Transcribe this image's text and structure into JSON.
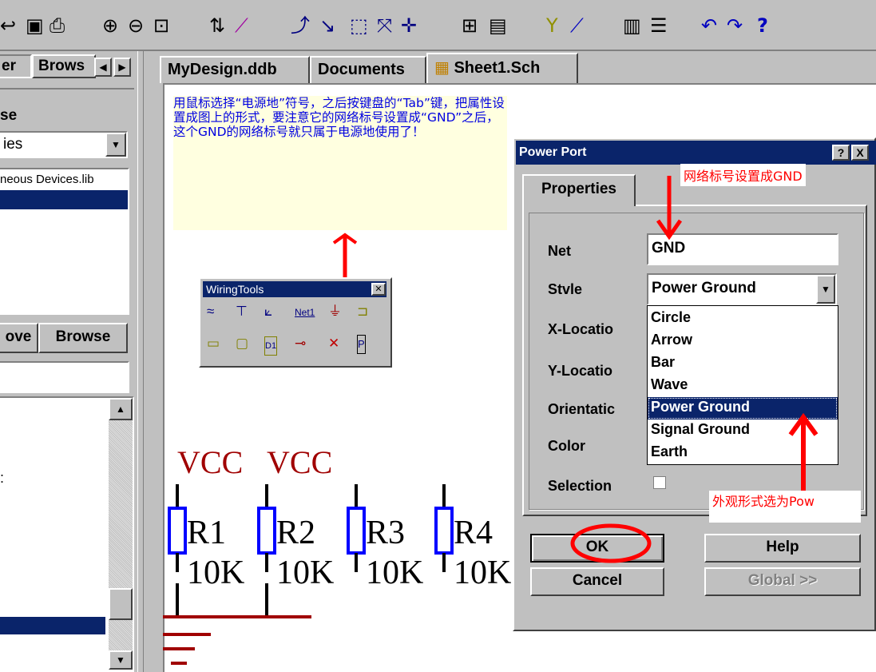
{
  "toolbar": {
    "icons": [
      "save-icon",
      "print-icon",
      "zoom-in-icon",
      "zoom-out-icon",
      "zoom-fit-icon",
      "sort-icon",
      "wand-icon",
      "wire-icon",
      "arrow-icon",
      "select-icon",
      "cross-icon",
      "move-icon",
      "bus-icon",
      "sheet-icon",
      "probe-icon",
      "line-icon",
      "library-icon",
      "list-icon",
      "undo-icon",
      "redo-icon",
      "help-icon"
    ],
    "help_label": "?"
  },
  "left_panel": {
    "tab_partial": "er",
    "tab_browse_partial": "Brows",
    "group_partial": "se",
    "library_select": "ies",
    "library_file": "neous Devices.lib",
    "left_button_partial": "ove",
    "browse_button": "Browse",
    "list_marker": ":"
  },
  "document_tabs": [
    "MyDesign.ddb",
    "Documents",
    "Sheet1.Sch"
  ],
  "note": {
    "text": "用鼠标选择“电源地”符号，之后按键盘的“Tab”键，把属性设置成图上的形式，要注意它的网络标号设置成“GND”之后，这个GND的网络标号就只属于电源地使用了！"
  },
  "wiring_tools": {
    "title": "WiringTools",
    "close": "✕",
    "net_label": "Net1",
    "row1": [
      "≈",
      "⊤",
      "⟀",
      "Net1",
      "⏚",
      "⊐"
    ],
    "row2": [
      "▭",
      "▢",
      "D1",
      "⊸",
      "✕",
      "P"
    ]
  },
  "schematic": {
    "vcc_labels": [
      "VCC",
      "VCC"
    ],
    "resistors": [
      {
        "ref": "R1",
        "value": "10K"
      },
      {
        "ref": "R2",
        "value": "10K"
      },
      {
        "ref": "R3",
        "value": "10K"
      },
      {
        "ref": "R4",
        "value": "10K"
      }
    ]
  },
  "dialog": {
    "title": "Power Port",
    "help_btn": "?",
    "close_btn": "X",
    "tab": "Properties",
    "fields": {
      "net_label": "Net",
      "net_value": "GND",
      "style_label": "Stvle",
      "style_value": "Power Ground",
      "xloc_label": "X-Locatio",
      "yloc_label": "Y-Locatio",
      "orient_label": "Orientatic",
      "color_label": "Color",
      "selection_label": "Selection"
    },
    "style_options": [
      "Circle",
      "Arrow",
      "Bar",
      "Wave",
      "Power Ground",
      "Signal Ground",
      "Earth"
    ],
    "selected_option": "Power Ground",
    "buttons": {
      "ok": "OK",
      "help": "Help",
      "cancel": "Cancel",
      "global": "Global >>"
    }
  },
  "annotations": {
    "net_note": "网络标号设置成GND",
    "style_note": "外观形式选为Pow"
  },
  "colors": {
    "title_bar": "#0a246a",
    "selection": "#0a246a",
    "note_text": "#0000e0",
    "schematic_red": "#a00000",
    "resistor_blue": "#0000ff",
    "annotation_red": "#ff0000"
  }
}
